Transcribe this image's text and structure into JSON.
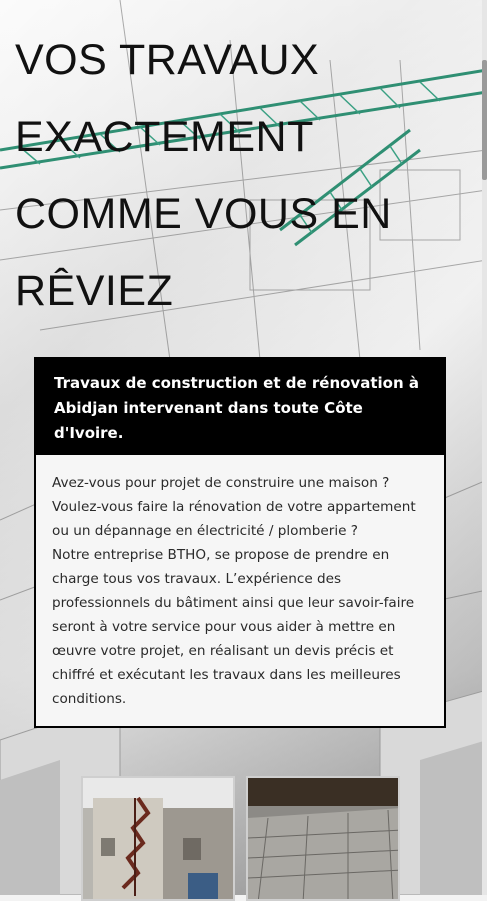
{
  "hero": {
    "title": "VOS TRAVAUX EXACTEMENT COMME VOUS EN RÊVIEZ"
  },
  "intro_card": {
    "heading": "Travaux de construction et de rénovation à Abidjan intervenant dans toute Côte d'Ivoire.",
    "paragraph_1": "Avez-vous pour projet de construire une maison ? Voulez-vous faire la rénovation de votre appartement ou un dépannage en électricité / plomberie ?",
    "paragraph_2": "Notre entreprise BTHO, se propose de prendre en charge tous vos travaux. L’expérience des professionnels du bâtiment ainsi que leur savoir-faire seront à votre service pour vous aider à mettre en œuvre votre projet, en réalisant un devis précis et chiffré et exécutant les travaux dans les meilleures conditions."
  },
  "gallery": {
    "items": [
      {
        "icon": "building-staircase-photo"
      },
      {
        "icon": "floor-screed-photo"
      }
    ]
  }
}
